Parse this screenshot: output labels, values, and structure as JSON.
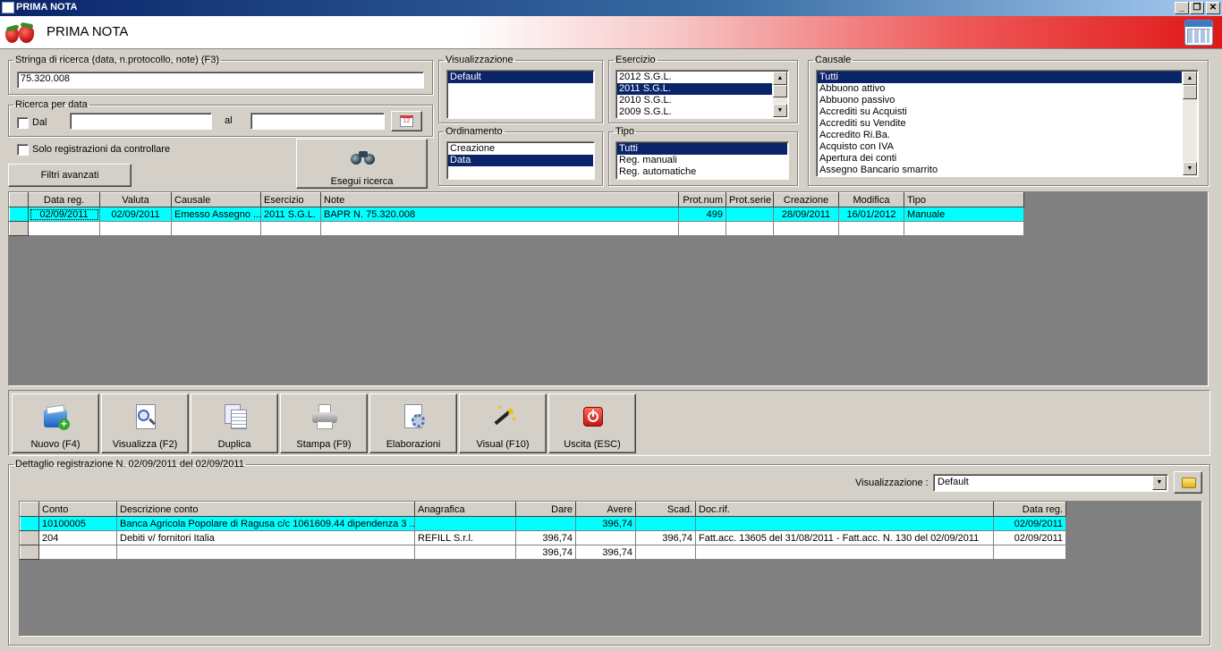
{
  "window": {
    "title": "PRIMA NOTA",
    "minimize": "_",
    "restore": "❐",
    "close": "✕"
  },
  "header": {
    "title": "PRIMA NOTA"
  },
  "search": {
    "legend": "Stringa di ricerca (data, n.protocollo, note) (F3)",
    "value": "75.320.008"
  },
  "date_search": {
    "legend": "Ricerca per data",
    "from_label": "Dal",
    "to_label": "al",
    "from_value": "",
    "to_value": "",
    "cal_icon_text": "12"
  },
  "only_check": {
    "label": "Solo registrazioni da controllare"
  },
  "advanced_filters": {
    "label": "Filtri avanzati"
  },
  "run_search": {
    "label": "Esegui ricerca"
  },
  "visualizzazione": {
    "legend": "Visualizzazione",
    "items": [
      "Default"
    ],
    "selected": 0
  },
  "ordinamento": {
    "legend": "Ordinamento",
    "items": [
      "Creazione",
      "Data"
    ],
    "selected": 1
  },
  "esercizio": {
    "legend": "Esercizio",
    "items": [
      "2012 S.G.L.",
      "2011 S.G.L.",
      "2010 S.G.L.",
      "2009 S.G.L."
    ],
    "selected": 1
  },
  "tipo": {
    "legend": "Tipo",
    "items": [
      "Tutti",
      "Reg. manuali",
      "Reg. automatiche"
    ],
    "selected": 0
  },
  "causale": {
    "legend": "Causale",
    "items": [
      "Tutti",
      "Abbuono attivo",
      "Abbuono passivo",
      "Accrediti su Acquisti",
      "Accrediti su Vendite",
      "Accredito Ri.Ba.",
      "Acquisto con IVA",
      "Apertura dei conti",
      "Assegno Bancario smarrito"
    ],
    "selected": 0
  },
  "main_grid": {
    "columns": [
      "Data reg.",
      "Valuta",
      "Causale",
      "Esercizio",
      "Note",
      "Prot.num",
      "Prot.serie",
      "Creazione",
      "Modifica",
      "Tipo"
    ],
    "rows": [
      [
        "02/09/2011",
        "02/09/2011",
        "Emesso Assegno ...",
        "2011 S.G.L.",
        "BAPR N. 75.320.008",
        "499",
        "",
        "28/09/2011",
        "16/01/2012",
        "Manuale"
      ],
      [
        "",
        "",
        "",
        "",
        "",
        "",
        "",
        "",
        "",
        ""
      ]
    ]
  },
  "toolbar": {
    "buttons": [
      {
        "label": "Nuovo (F4)",
        "icon": "new-icon"
      },
      {
        "label": "Visualizza (F2)",
        "icon": "view-icon"
      },
      {
        "label": "Duplica",
        "icon": "duplicate-icon"
      },
      {
        "label": "Stampa (F9)",
        "icon": "print-icon"
      },
      {
        "label": "Elaborazioni",
        "icon": "process-icon"
      },
      {
        "label": "Visual (F10)",
        "icon": "wand-icon"
      },
      {
        "label": "Uscita (ESC)",
        "icon": "exit-icon"
      }
    ]
  },
  "detail": {
    "legend": "Dettaglio registrazione N. 02/09/2011 del 02/09/2011",
    "view_label": "Visualizzazione :",
    "view_value": "Default",
    "columns": [
      "Conto",
      "Descrizione conto",
      "Anagrafica",
      "Dare",
      "Avere",
      "Scad.",
      "Doc.rif.",
      "Data reg."
    ],
    "rows": [
      [
        "10100005",
        "Banca Agricola Popolare di Ragusa c/c 1061609.44 dipendenza 3 ...",
        "",
        "",
        "396,74",
        "",
        "",
        "02/09/2011"
      ],
      [
        "204",
        "Debiti v/ fornitori Italia",
        "REFILL S.r.l.",
        "396,74",
        "",
        "396,74",
        "Fatt.acc. 13605 del 31/08/2011 - Fatt.acc. N. 130 del 02/09/2011",
        "02/09/2011"
      ],
      [
        "",
        "",
        "",
        "396,74",
        "396,74",
        "",
        "",
        ""
      ]
    ]
  },
  "colors": {
    "selection": "#0a246a",
    "highlight_row": "#00ffff",
    "window_bg": "#d4d0c8",
    "grid_bg": "#808080"
  }
}
